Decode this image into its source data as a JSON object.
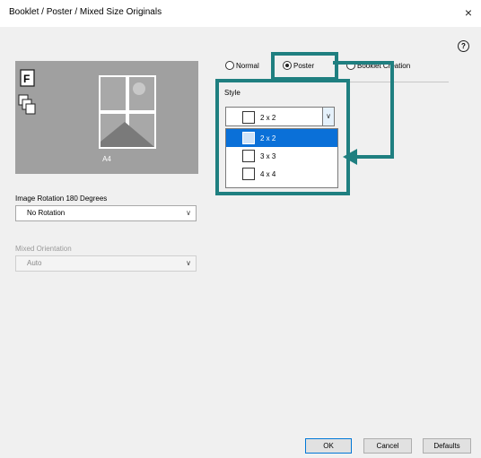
{
  "window": {
    "title": "Booklet / Poster / Mixed Size Originals",
    "close": "×",
    "help": "?"
  },
  "preview": {
    "caption": "A4"
  },
  "mode": {
    "normal": "Normal",
    "poster": "Poster",
    "booklet": "Booklet Creation",
    "selected": "Poster"
  },
  "style": {
    "label": "Style",
    "value": "2 x 2",
    "options": [
      "2 x 2",
      "3 x 3",
      "4 x 4"
    ],
    "selected_index": 0
  },
  "rotation": {
    "label": "Image Rotation 180 Degrees",
    "value": "No Rotation"
  },
  "mixed": {
    "label": "Mixed Orientation",
    "value": "Auto"
  },
  "buttons": {
    "ok": "OK",
    "cancel": "Cancel",
    "defaults": "Defaults"
  },
  "colors": {
    "callout": "#1f7f80",
    "selection": "#0a70d8",
    "preview_bg": "#a0a0a0"
  }
}
